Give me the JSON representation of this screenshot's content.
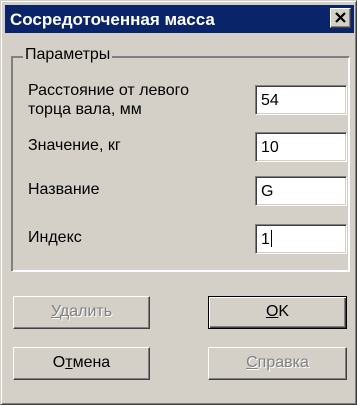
{
  "window": {
    "title": "Сосредоточенная масса",
    "close_icon": "close-x-icon"
  },
  "params": {
    "group_title": "Параметры",
    "fields": [
      {
        "label_line1": "Расстояние от левого",
        "label_line2": "торца вала, мм",
        "value": "54"
      },
      {
        "label": "Значение, кг",
        "value": "10"
      },
      {
        "label": "Название",
        "value": "G"
      },
      {
        "label": "Индекс",
        "value": "1"
      }
    ]
  },
  "buttons": {
    "delete": {
      "mnemonic": "У",
      "rest": "далить",
      "enabled": false
    },
    "ok": {
      "mnemonic": "O",
      "rest": "K",
      "enabled": true
    },
    "cancel": {
      "pre": "О",
      "mnemonic": "т",
      "rest": "мена",
      "enabled": true
    },
    "help": {
      "mnemonic": "С",
      "rest": "правка",
      "enabled": false
    }
  },
  "colors": {
    "title_bar": "#0a246a",
    "face": "#d4d0c8",
    "disabled_text": "#808080"
  }
}
